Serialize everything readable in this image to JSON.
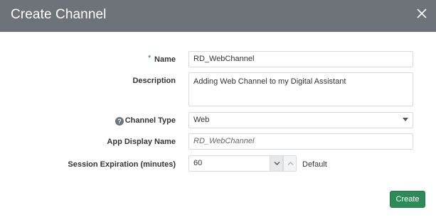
{
  "dialog": {
    "title": "Create Channel",
    "close_icon": "close-icon"
  },
  "form": {
    "name": {
      "required_marker": "*",
      "label": "Name",
      "value": "RD_WebChannel"
    },
    "description": {
      "label": "Description",
      "value": "Adding Web Channel to my Digital Assistant"
    },
    "channel_type": {
      "help_icon": "?",
      "label": "Channel Type",
      "selected": "Web"
    },
    "app_display_name": {
      "label": "App Display Name",
      "placeholder": "RD_WebChannel"
    },
    "session_expiration": {
      "label": "Session Expiration (minutes)",
      "value": "60",
      "suffix": "Default"
    }
  },
  "footer": {
    "create_label": "Create"
  },
  "colors": {
    "header_bg": "#6d7378",
    "primary_button": "#2e8b57",
    "required_marker": "#2a6db0"
  }
}
